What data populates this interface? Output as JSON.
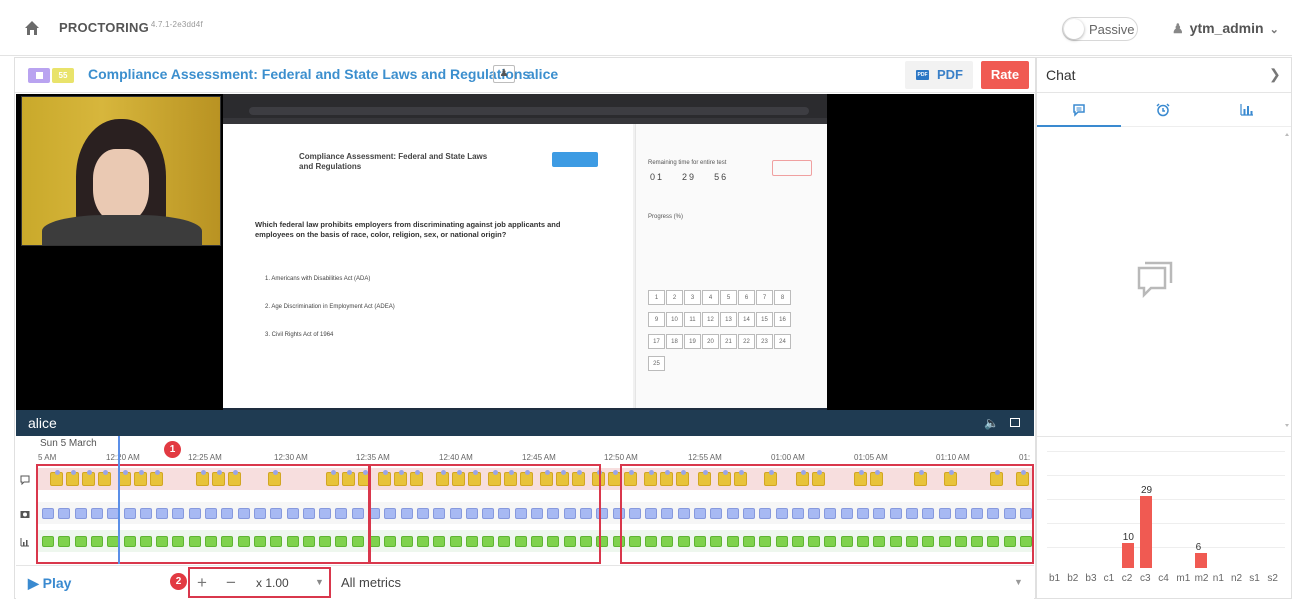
{
  "topbar": {
    "brand": "PROCTORING",
    "version": "4.7.1-2e3dd4f",
    "passive_label": "Passive",
    "username": "ytm_admin"
  },
  "session": {
    "badge_count": "55",
    "title": "Compliance Assessment: Federal and State Laws and Regulations",
    "user": "alice",
    "pdf_label": "PDF",
    "rate_label": "Rate"
  },
  "video": {
    "name": "alice"
  },
  "screen": {
    "question_title": "Compliance Assessment: Federal and State Laws and Regulations",
    "question": "Which federal law prohibits employers from discriminating against job applicants and employees on the basis of race, color, religion, sex, or national origin?",
    "options": [
      "1.  Americans with Disabilities Act (ADA)",
      "2.  Age Discrimination in Employment Act (ADEA)",
      "3.  Civil Rights Act of 1964"
    ],
    "timer_label": "Remaining time for entire test",
    "timer": [
      "01",
      "29",
      "56"
    ],
    "progress_label": "Progress (%)",
    "grid": [
      "1",
      "2",
      "3",
      "4",
      "5",
      "6",
      "7",
      "8",
      "9",
      "10",
      "11",
      "12",
      "13",
      "14",
      "15",
      "16",
      "17",
      "18",
      "19",
      "20",
      "21",
      "22",
      "23",
      "24",
      "25"
    ]
  },
  "timeline": {
    "date": "Sun 5 March",
    "ticks": [
      "5 AM",
      "12:20 AM",
      "12:25 AM",
      "12:30 AM",
      "12:35 AM",
      "12:40 AM",
      "12:45 AM",
      "12:50 AM",
      "12:55 AM",
      "01:00 AM",
      "01:05 AM",
      "01:10 AM",
      "01:"
    ],
    "markers": [
      "1",
      "2"
    ]
  },
  "controls": {
    "play_label": "Play",
    "zoom_in": "+",
    "zoom_out": "−",
    "speed": "x 1.00",
    "metrics_label": "All metrics"
  },
  "chat": {
    "title": "Chat"
  },
  "chart_data": {
    "type": "bar",
    "categories": [
      "b1",
      "b2",
      "b3",
      "c1",
      "c2",
      "c3",
      "c4",
      "m1",
      "m2",
      "n1",
      "n2",
      "s1",
      "s2"
    ],
    "values": [
      0,
      0,
      0,
      0,
      10,
      29,
      0,
      0,
      6,
      0,
      0,
      0,
      0
    ],
    "labels": [
      "",
      "",
      "",
      "",
      "10",
      "29",
      "",
      "",
      "6",
      "",
      "",
      "",
      ""
    ],
    "color": "#f05a52"
  },
  "colors": {
    "accent": "#3a8ad0",
    "rate": "#f05a52",
    "highlight": "#d9374c"
  }
}
